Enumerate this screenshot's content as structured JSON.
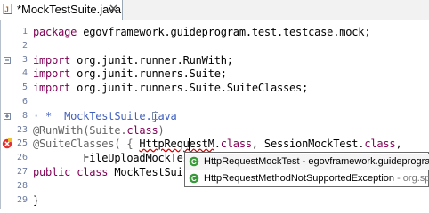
{
  "tab": {
    "title": "*MockTestSuite.java",
    "close_symbol": "✕"
  },
  "editor": {
    "lines": [
      {
        "num": "1",
        "segments": [
          {
            "t": "package",
            "c": "kw"
          },
          {
            "t": " egovframework.guideprogram.test.testcase.mock;",
            "c": ""
          }
        ]
      },
      {
        "num": "2",
        "segments": []
      },
      {
        "num": "3",
        "segments": [
          {
            "t": "import",
            "c": "kw"
          },
          {
            "t": " org.junit.runner.RunWith;",
            "c": ""
          }
        ]
      },
      {
        "num": "4",
        "segments": [
          {
            "t": "import",
            "c": "kw"
          },
          {
            "t": " org.junit.runners.Suite;",
            "c": ""
          }
        ]
      },
      {
        "num": "5",
        "segments": [
          {
            "t": "import",
            "c": "kw"
          },
          {
            "t": " org.junit.runners.Suite.SuiteClasses;",
            "c": ""
          }
        ]
      },
      {
        "num": "6",
        "segments": []
      },
      {
        "num": "8",
        "segments": [
          {
            "t": "· *  MockTestSuite.java",
            "c": "jd"
          }
        ]
      },
      {
        "num": "23",
        "segments": [
          {
            "t": "@RunWith(Suite.",
            "c": "ann"
          },
          {
            "t": "class",
            "c": "kw"
          },
          {
            "t": ")",
            "c": "ann"
          }
        ]
      },
      {
        "num": "25",
        "segments": [
          {
            "t": "@SuiteClasses( { ",
            "c": "ann"
          },
          {
            "t": "HttpRequestM",
            "c": "err"
          },
          {
            "t": ".",
            "c": ""
          },
          {
            "t": "class",
            "c": "kw"
          },
          {
            "t": ", SessionMockTest.",
            "c": ""
          },
          {
            "t": "class",
            "c": "kw"
          },
          {
            "t": ",",
            "c": ""
          }
        ]
      },
      {
        "num": "26",
        "segments": [
          {
            "t": "        FileUploadMockTest.c",
            "c": ""
          }
        ]
      },
      {
        "num": "27",
        "segments": [
          {
            "t": "public",
            "c": "kw"
          },
          {
            "t": " ",
            "c": ""
          },
          {
            "t": "class",
            "c": "kw"
          },
          {
            "t": " MockTestSuite {",
            "c": ""
          }
        ]
      },
      {
        "num": "28",
        "segments": []
      },
      {
        "num": "29",
        "segments": [
          {
            "t": "}",
            "c": ""
          }
        ]
      }
    ]
  },
  "autocomplete": {
    "items": [
      {
        "name": "HttpRequestMockTest",
        "pkg": " - egovframework.guideprogra",
        "icon": "class-icon"
      },
      {
        "name": "HttpRequestMethodNotSupportedException",
        "pkg": " - org.sp",
        "icon": "class-icon"
      }
    ]
  },
  "colors": {
    "keyword": "#7f0055",
    "annotation": "#646464",
    "javadoc": "#3f5fbf",
    "line_number": "#6c7ba0",
    "class_icon": "#3a9a3a"
  }
}
